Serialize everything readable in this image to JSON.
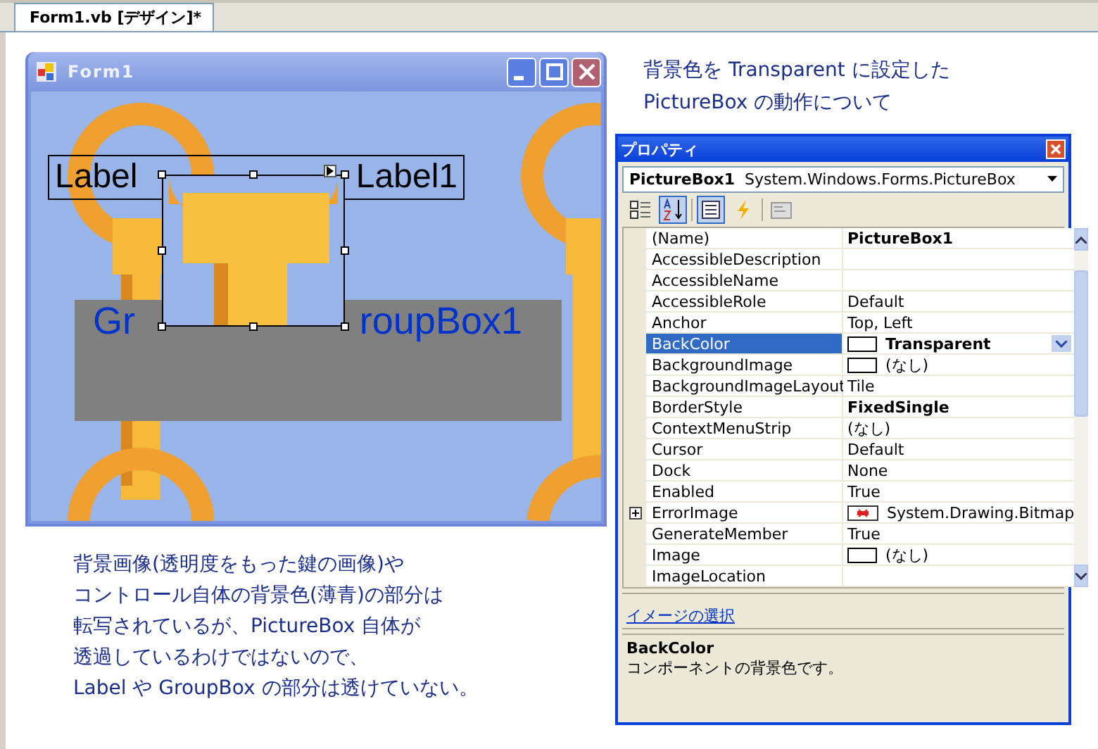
{
  "document_tab": {
    "label": "Form1.vb [デザイン]*",
    "selected": true
  },
  "form": {
    "title": "Form1",
    "label_left": "Label",
    "label_right": "Label1",
    "groupbox_left": "Gr",
    "groupbox_right": "roupBox1"
  },
  "caption": [
    "背景色を Transparent に設定した",
    "PictureBox の動作について"
  ],
  "properties": {
    "title": "プロパティ",
    "object_name": "PictureBox1",
    "object_type": "System.Windows.Forms.PictureBox",
    "rows": [
      {
        "name": "(Name)",
        "value": "PictureBox1",
        "bold": true,
        "kind": "text",
        "selected": false
      },
      {
        "name": "AccessibleDescription",
        "value": "",
        "kind": "text",
        "selected": false
      },
      {
        "name": "AccessibleName",
        "value": "",
        "kind": "text",
        "selected": false
      },
      {
        "name": "AccessibleRole",
        "value": "Default",
        "bold": false,
        "kind": "text",
        "selected": false
      },
      {
        "name": "Anchor",
        "value": "Top, Left",
        "bold": false,
        "kind": "text",
        "selected": false
      },
      {
        "name": "BackColor",
        "value": "Transparent",
        "bold": true,
        "kind": "swatch",
        "selected": true
      },
      {
        "name": "BackgroundImage",
        "value": "(なし)",
        "bold": false,
        "kind": "swatch",
        "selected": false
      },
      {
        "name": "BackgroundImageLayout",
        "value": "Tile",
        "bold": false,
        "kind": "text",
        "selected": false
      },
      {
        "name": "BorderStyle",
        "value": "FixedSingle",
        "bold": true,
        "kind": "text",
        "selected": false
      },
      {
        "name": "ContextMenuStrip",
        "value": "(なし)",
        "bold": false,
        "kind": "text",
        "selected": false
      },
      {
        "name": "Cursor",
        "value": "Default",
        "bold": false,
        "kind": "text",
        "selected": false
      },
      {
        "name": "Dock",
        "value": "None",
        "bold": false,
        "kind": "text",
        "selected": false
      },
      {
        "name": "Enabled",
        "value": "True",
        "bold": false,
        "kind": "text",
        "selected": false
      },
      {
        "name": "ErrorImage",
        "value": "System.Drawing.Bitmap",
        "bold": false,
        "kind": "error",
        "selected": false,
        "expanded": false
      },
      {
        "name": "GenerateMember",
        "value": "True",
        "bold": false,
        "kind": "text",
        "selected": false
      },
      {
        "name": "Image",
        "value": "(なし)",
        "bold": false,
        "kind": "swatch",
        "selected": false
      },
      {
        "name": "ImageLocation",
        "value": "",
        "kind": "text",
        "selected": false
      }
    ],
    "command_link": "イメージの選択",
    "help_title": "BackColor",
    "help_text": "コンポーネントの背景色です。"
  },
  "explanation": [
    "背景画像(透明度をもった鍵の画像)や",
    "コントロール自体の背景色(薄青)の部分は",
    "転写されているが、PictureBox 自体が",
    "透過しているわけではないので、",
    "Label や GroupBox の部分は透けていない。"
  ]
}
